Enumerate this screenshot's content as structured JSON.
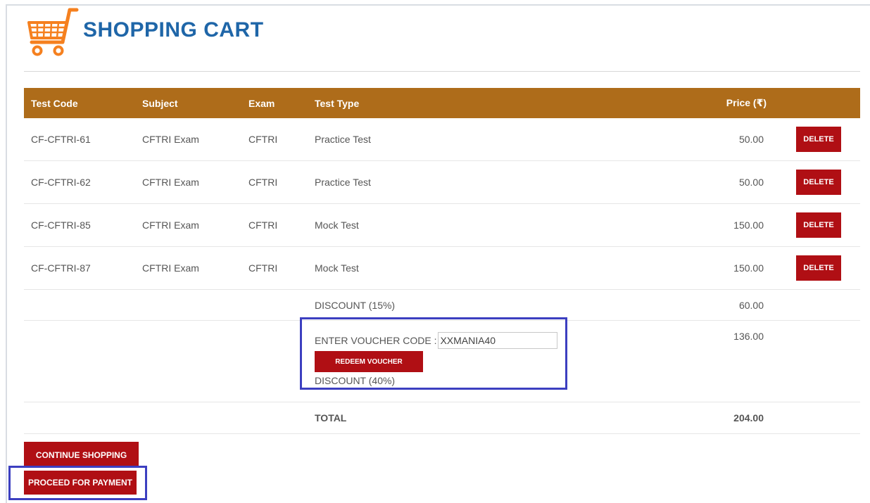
{
  "header": {
    "title": "SHOPPING CART",
    "icon": "shopping-cart-icon",
    "icon_color": "#f5801f"
  },
  "table": {
    "columns": [
      "Test Code",
      "Subject",
      "Exam",
      "Test Type",
      "Price (₹)"
    ],
    "rows": [
      {
        "code": "CF-CFTRI-61",
        "subject": "CFTRI Exam",
        "exam": "CFTRI",
        "type": "Practice Test",
        "price": "50.00"
      },
      {
        "code": "CF-CFTRI-62",
        "subject": "CFTRI Exam",
        "exam": "CFTRI",
        "type": "Practice Test",
        "price": "50.00"
      },
      {
        "code": "CF-CFTRI-85",
        "subject": "CFTRI Exam",
        "exam": "CFTRI",
        "type": "Mock Test",
        "price": "150.00"
      },
      {
        "code": "CF-CFTRI-87",
        "subject": "CFTRI Exam",
        "exam": "CFTRI",
        "type": "Mock Test",
        "price": "150.00"
      }
    ],
    "delete_label": "DELETE",
    "discount": {
      "label": "DISCOUNT (15%)",
      "value": "60.00"
    },
    "voucher": {
      "label": "ENTER VOUCHER CODE :",
      "input_value": "XXMANIA40",
      "redeem_label": "REDEEM VOUCHER",
      "discount_label": "DISCOUNT (40%)",
      "value": "136.00"
    },
    "total": {
      "label": "TOTAL",
      "value": "204.00"
    }
  },
  "actions": {
    "continue_label": "CONTINUE SHOPPING",
    "payment_label": "PROCEED FOR PAYMENT"
  },
  "colors": {
    "header_bg": "#ae6c1a",
    "button_bg": "#b00f14",
    "title_color": "#1f66a8",
    "highlight_border": "#3c3fc0"
  }
}
